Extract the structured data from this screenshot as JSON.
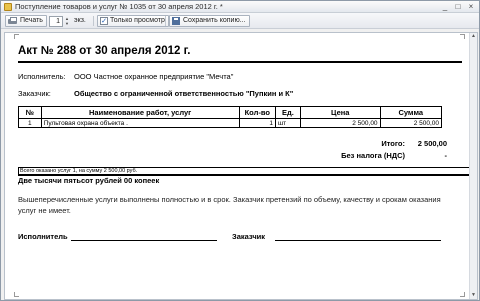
{
  "window": {
    "title": "Поступление товаров и услуг № 1035 от 30 апреля 2012 г. *",
    "controls": [
      "_",
      "□",
      "×"
    ]
  },
  "toolbar": {
    "print_label": "Печать",
    "copies_value": "1",
    "copies_unit": "экз.",
    "view_only_label": "Только просмотр",
    "save_copy_label": "Сохранить копию..."
  },
  "document": {
    "title": "Акт № 288 от 30 апреля 2012 г.",
    "executor_label": "Исполнитель:",
    "executor_value": "ООО Частное охранное предприятие \"Мечта\"",
    "customer_label": "Заказчик:",
    "customer_value": "Общество с ограниченной ответственностью \"Пупкин и К\"",
    "table": {
      "headers": [
        "№",
        "Наименование работ, услуг",
        "Кол-во",
        "Ед.",
        "Цена",
        "Сумма"
      ],
      "rows": [
        [
          "1",
          "Пультовая охрана объекта .",
          "1",
          "шт",
          "2 500,00",
          "2 500,00"
        ]
      ]
    },
    "total_label": "Итого:",
    "total_value": "2 500,00",
    "vat_label": "Без налога (НДС)",
    "vat_value": "-",
    "summary_text": "Всего оказано услуг 1, на сумму 2 500,00 руб.",
    "amount_words": "Две тысячи пятьсот рублей 00 копеек",
    "note": "Вышеперечисленные услуги выполнены полностью и в срок. Заказчик претензий по объему, качеству и срокам оказания услуг не имеет.",
    "sign_executor_label": "Исполнитель",
    "sign_customer_label": "Заказчик"
  }
}
